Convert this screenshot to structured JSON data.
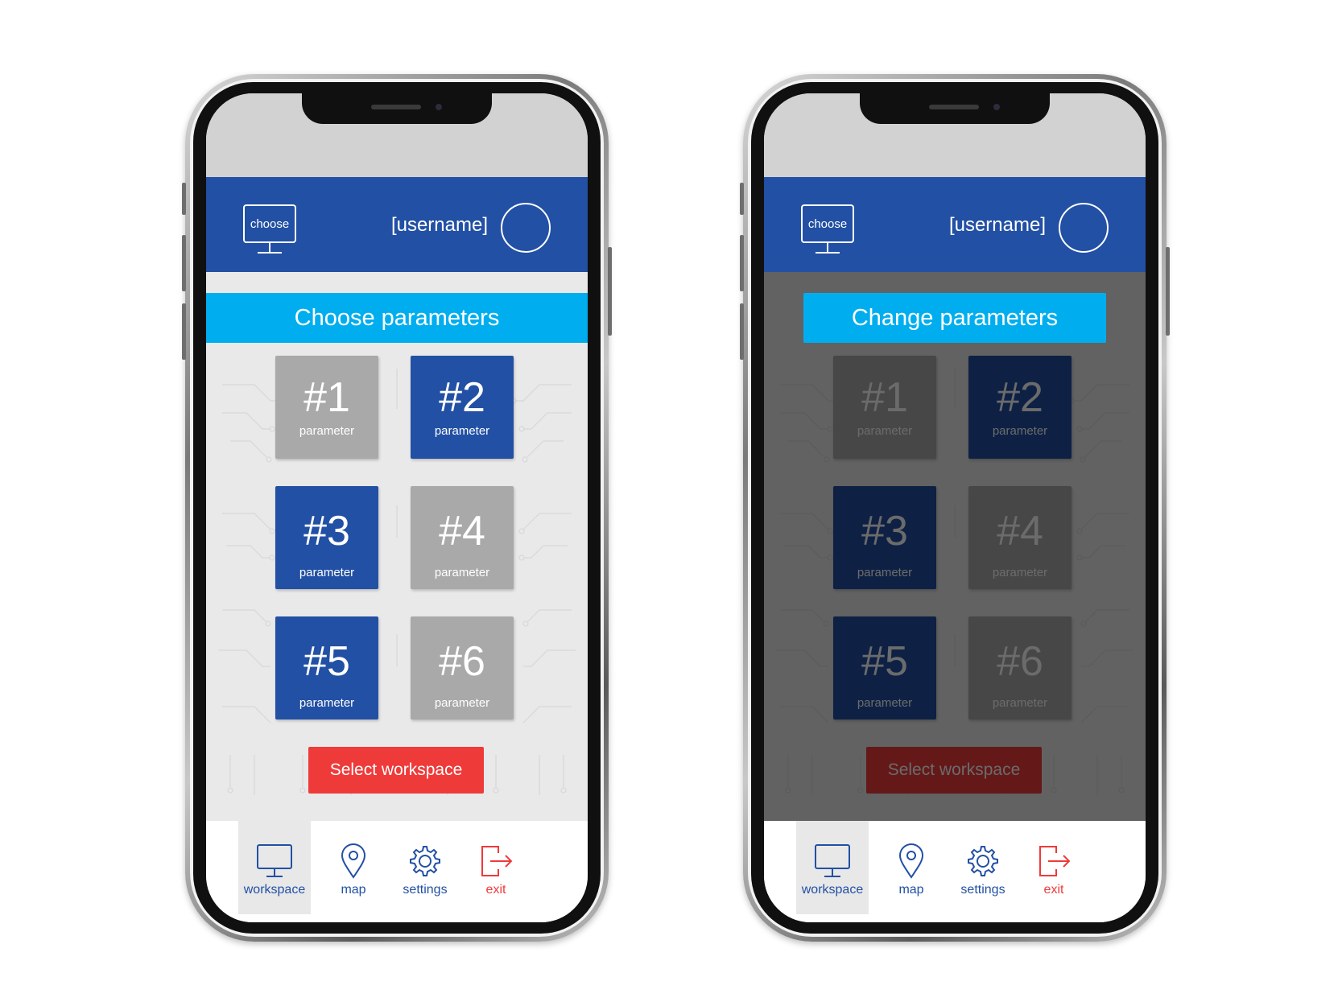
{
  "phones": [
    {
      "header": {
        "device_label": "choose",
        "username": "[username]"
      },
      "title": "Choose parameters",
      "params": [
        {
          "number": "#1",
          "label": "parameter"
        },
        {
          "number": "#2",
          "label": "parameter"
        },
        {
          "number": "#3",
          "label": "parameter"
        },
        {
          "number": "#4",
          "label": "parameter"
        },
        {
          "number": "#5",
          "label": "parameter"
        },
        {
          "number": "#6",
          "label": "parameter"
        }
      ],
      "select_button": "Select workspace",
      "nav": [
        {
          "label": "workspace",
          "icon": "monitor-icon"
        },
        {
          "label": "map",
          "icon": "map-pin-icon"
        },
        {
          "label": "settings",
          "icon": "gear-icon"
        },
        {
          "label": "exit",
          "icon": "exit-icon"
        }
      ]
    },
    {
      "header": {
        "device_label": "choose",
        "username": "[username]"
      },
      "title": "Change parameters",
      "params": [
        {
          "number": "#1",
          "label": "parameter"
        },
        {
          "number": "#2",
          "label": "parameter"
        },
        {
          "number": "#3",
          "label": "parameter"
        },
        {
          "number": "#4",
          "label": "parameter"
        },
        {
          "number": "#5",
          "label": "parameter"
        },
        {
          "number": "#6",
          "label": "parameter"
        }
      ],
      "select_button": "Select workspace",
      "nav": [
        {
          "label": "workspace",
          "icon": "monitor-icon"
        },
        {
          "label": "map",
          "icon": "map-pin-icon"
        },
        {
          "label": "settings",
          "icon": "gear-icon"
        },
        {
          "label": "exit",
          "icon": "exit-icon"
        }
      ]
    }
  ],
  "colors": {
    "primary_blue": "#2250a4",
    "accent_cyan": "#00aeef",
    "action_red": "#ef3a3a",
    "tile_grey": "#a9a9a9"
  }
}
